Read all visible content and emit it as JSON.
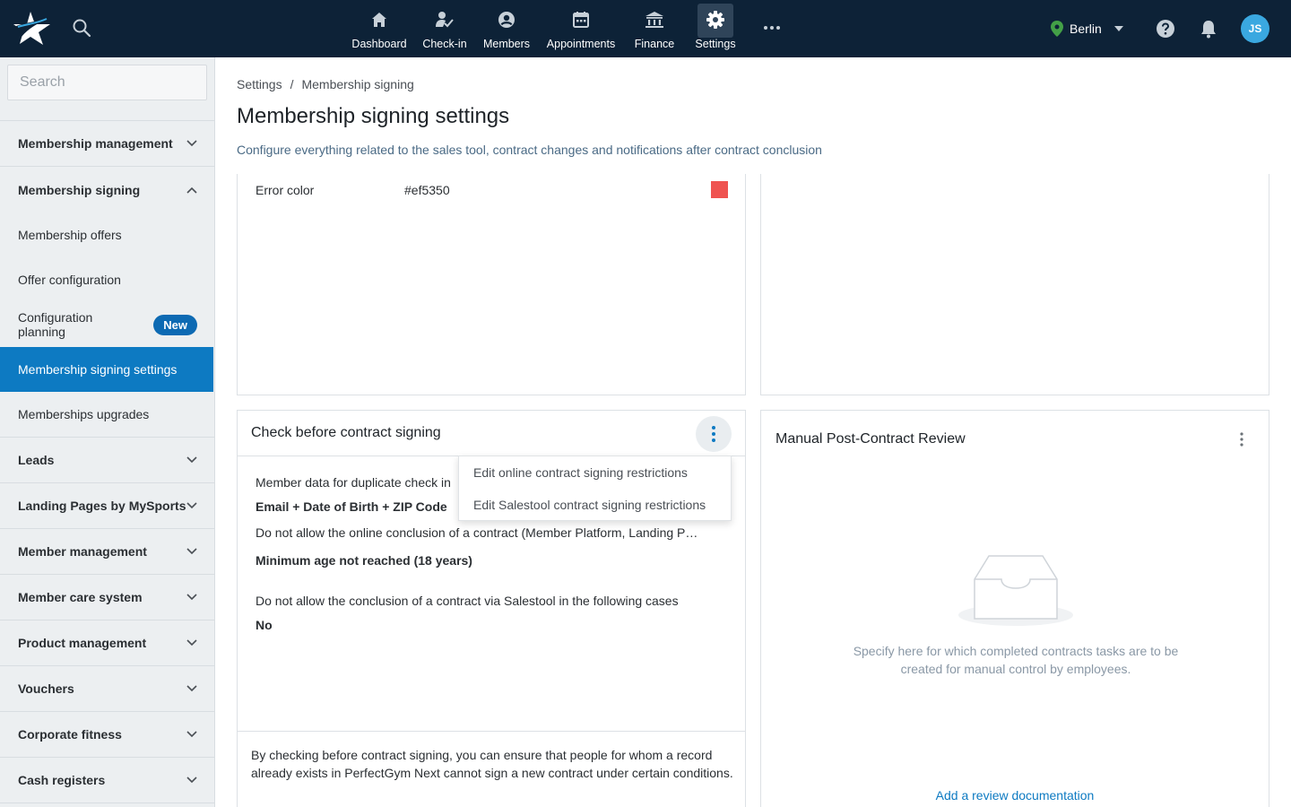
{
  "topbar": {
    "nav": [
      {
        "label": "Dashboard",
        "icon": "home-icon"
      },
      {
        "label": "Check-in",
        "icon": "check-in-icon"
      },
      {
        "label": "Members",
        "icon": "member-icon"
      },
      {
        "label": "Appointments",
        "icon": "calendar-icon"
      },
      {
        "label": "Finance",
        "icon": "bank-icon"
      },
      {
        "label": "Settings",
        "icon": "gear-icon",
        "active": true
      }
    ],
    "location": "Berlin",
    "avatar_initials": "JS"
  },
  "sidebar": {
    "search_placeholder": "Search",
    "groups": {
      "membership_management": "Membership management",
      "membership_signing": "Membership signing",
      "leads": "Leads",
      "landing_pages": "Landing Pages by MySports",
      "member_management": "Member management",
      "member_care": "Member care system",
      "product_management": "Product management",
      "vouchers": "Vouchers",
      "corporate_fitness": "Corporate fitness",
      "cash_registers": "Cash registers"
    },
    "sub_items": {
      "membership_offers": "Membership offers",
      "offer_configuration": "Offer configuration",
      "configuration_planning": "Configuration planning",
      "configuration_planning_badge": "New",
      "membership_signing_settings": "Membership signing settings",
      "memberships_upgrades": "Memberships upgrades"
    }
  },
  "main": {
    "breadcrumb": {
      "root": "Settings",
      "separator": "/",
      "current": "Membership signing"
    },
    "title": "Membership signing settings",
    "subtitle": "Configure everything related to the sales tool, contract changes and notifications after contract conclusion",
    "color_card": {
      "label": "Error color",
      "value": "#ef5350",
      "swatch": "#ef5350"
    },
    "check_card": {
      "title": "Check before contract signing",
      "duplicate_label": "Member data for duplicate check in",
      "duplicate_value": "Email + Date of Birth + ZIP Code",
      "online_label": "Do not allow the online conclusion of a contract (Member Platform, Landing P…",
      "online_value": "Minimum age not reached (18 years)",
      "salestool_label": "Do not allow the conclusion of a contract via Salestool in the following cases",
      "salestool_value": "No",
      "footer": "By checking before contract signing, you can ensure that people for whom a record already exists in PerfectGym Next cannot sign a new contract under certain conditions."
    },
    "menu": {
      "items": [
        "Edit online contract signing restrictions",
        "Edit Salestool contract signing restrictions"
      ]
    },
    "review_card": {
      "title": "Manual Post-Contract Review",
      "empty_text": "Specify here for which completed contracts tasks are to be created for manual control by employees.",
      "link": "Add a review documentation"
    }
  }
}
